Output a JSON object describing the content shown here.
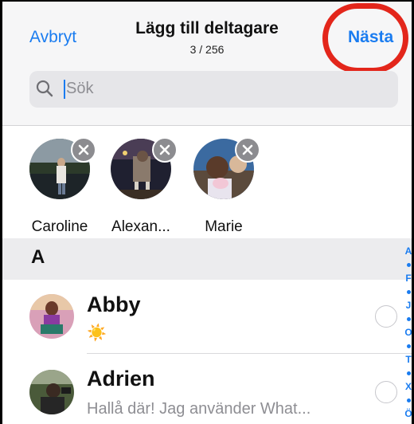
{
  "header": {
    "cancel_label": "Avbryt",
    "title": "Lägg till deltagare",
    "count": "3 / 256",
    "next_label": "Nästa"
  },
  "search": {
    "placeholder": "Sök"
  },
  "selected": [
    {
      "name": "Caroline"
    },
    {
      "name": "Alexan..."
    },
    {
      "name": "Marie"
    }
  ],
  "section": {
    "letter": "A"
  },
  "contacts": [
    {
      "name": "Abby",
      "status": "☀️"
    },
    {
      "name": "Adrien",
      "status": "Hallå där! Jag använder What..."
    }
  ],
  "index_letters": [
    "A",
    "F",
    "J",
    "O",
    "T",
    "X",
    "Ö"
  ],
  "colors": {
    "accent": "#1a7cf0",
    "highlight_ring": "#e3261b"
  }
}
